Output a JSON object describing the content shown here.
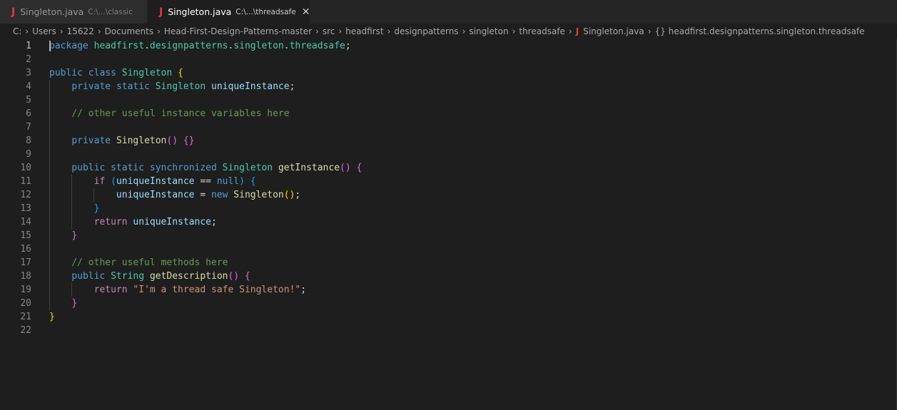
{
  "tabs": [
    {
      "name": "Singleton.java",
      "path": "C:\\...\\classic",
      "active": false
    },
    {
      "name": "Singleton.java",
      "path": "C:\\...\\threadsafe",
      "active": true
    }
  ],
  "breadcrumb": [
    "C:",
    "Users",
    "15622",
    "Documents",
    "Head-First-Design-Patterns-master",
    "src",
    "headfirst",
    "designpatterns",
    "singleton",
    "threadsafe",
    "Singleton.java",
    "headfirst.designpatterns.singleton.threadsafe"
  ],
  "icons": {
    "java": "java-file-icon",
    "close": "close-icon",
    "namespace": "braces-icon",
    "chevron": "chevron-right-icon"
  },
  "colors": {
    "java_icon": "#e03c3c",
    "background": "#1e1e1e",
    "keyword": "#569cd6",
    "class": "#4ec9b0",
    "comment": "#6a9955",
    "string": "#ce9178"
  },
  "line_numbers": [
    "1",
    "2",
    "3",
    "4",
    "5",
    "6",
    "7",
    "8",
    "9",
    "10",
    "11",
    "12",
    "13",
    "14",
    "15",
    "16",
    "17",
    "18",
    "19",
    "20",
    "21",
    "22"
  ],
  "current_line": 1,
  "code": [
    {
      "tokens": [
        [
          "kw",
          "package"
        ],
        [
          "op",
          " "
        ],
        [
          "pkg",
          "headfirst"
        ],
        [
          "op",
          "."
        ],
        [
          "pkg",
          "designpatterns"
        ],
        [
          "op",
          "."
        ],
        [
          "pkg",
          "singleton"
        ],
        [
          "op",
          "."
        ],
        [
          "pkg",
          "threadsafe"
        ],
        [
          "op",
          ";"
        ]
      ]
    },
    {
      "tokens": []
    },
    {
      "tokens": [
        [
          "kw",
          "public"
        ],
        [
          "op",
          " "
        ],
        [
          "kw",
          "class"
        ],
        [
          "op",
          " "
        ],
        [
          "cls",
          "Singleton"
        ],
        [
          "op",
          " "
        ],
        [
          "p1",
          "{"
        ]
      ]
    },
    {
      "tokens": [
        [
          "op",
          "    "
        ],
        [
          "kw",
          "private"
        ],
        [
          "op",
          " "
        ],
        [
          "kw",
          "static"
        ],
        [
          "op",
          " "
        ],
        [
          "cls",
          "Singleton"
        ],
        [
          "op",
          " "
        ],
        [
          "var",
          "uniqueInstance"
        ],
        [
          "op",
          ";"
        ]
      ]
    },
    {
      "tokens": []
    },
    {
      "tokens": [
        [
          "op",
          "    "
        ],
        [
          "cm",
          "// other useful instance variables here"
        ]
      ]
    },
    {
      "tokens": []
    },
    {
      "tokens": [
        [
          "op",
          "    "
        ],
        [
          "kw",
          "private"
        ],
        [
          "op",
          " "
        ],
        [
          "fn",
          "Singleton"
        ],
        [
          "p2",
          "()"
        ],
        [
          "op",
          " "
        ],
        [
          "p2",
          "{}"
        ]
      ]
    },
    {
      "tokens": []
    },
    {
      "tokens": [
        [
          "op",
          "    "
        ],
        [
          "kw",
          "public"
        ],
        [
          "op",
          " "
        ],
        [
          "kw",
          "static"
        ],
        [
          "op",
          " "
        ],
        [
          "kw",
          "synchronized"
        ],
        [
          "op",
          " "
        ],
        [
          "cls",
          "Singleton"
        ],
        [
          "op",
          " "
        ],
        [
          "fn",
          "getInstance"
        ],
        [
          "p2",
          "()"
        ],
        [
          "op",
          " "
        ],
        [
          "p2",
          "{"
        ]
      ]
    },
    {
      "tokens": [
        [
          "op",
          "        "
        ],
        [
          "kw2",
          "if"
        ],
        [
          "op",
          " "
        ],
        [
          "p3",
          "("
        ],
        [
          "var",
          "uniqueInstance"
        ],
        [
          "op",
          " == "
        ],
        [
          "kw",
          "null"
        ],
        [
          "p3",
          ")"
        ],
        [
          "op",
          " "
        ],
        [
          "p3",
          "{"
        ]
      ]
    },
    {
      "tokens": [
        [
          "op",
          "            "
        ],
        [
          "var",
          "uniqueInstance"
        ],
        [
          "op",
          " = "
        ],
        [
          "kw",
          "new"
        ],
        [
          "op",
          " "
        ],
        [
          "fn",
          "Singleton"
        ],
        [
          "p1",
          "()"
        ],
        [
          "op",
          ";"
        ]
      ]
    },
    {
      "tokens": [
        [
          "op",
          "        "
        ],
        [
          "p3",
          "}"
        ]
      ]
    },
    {
      "tokens": [
        [
          "op",
          "        "
        ],
        [
          "kw2",
          "return"
        ],
        [
          "op",
          " "
        ],
        [
          "var",
          "uniqueInstance"
        ],
        [
          "op",
          ";"
        ]
      ]
    },
    {
      "tokens": [
        [
          "op",
          "    "
        ],
        [
          "p2",
          "}"
        ]
      ]
    },
    {
      "tokens": []
    },
    {
      "tokens": [
        [
          "op",
          "    "
        ],
        [
          "cm",
          "// other useful methods here"
        ]
      ]
    },
    {
      "tokens": [
        [
          "op",
          "    "
        ],
        [
          "kw",
          "public"
        ],
        [
          "op",
          " "
        ],
        [
          "ty",
          "String"
        ],
        [
          "op",
          " "
        ],
        [
          "fn",
          "getDescription"
        ],
        [
          "p2",
          "()"
        ],
        [
          "op",
          " "
        ],
        [
          "p2",
          "{"
        ]
      ]
    },
    {
      "tokens": [
        [
          "op",
          "        "
        ],
        [
          "kw2",
          "return"
        ],
        [
          "op",
          " "
        ],
        [
          "str",
          "\"I'm a thread safe Singleton!\""
        ],
        [
          "op",
          ";"
        ]
      ]
    },
    {
      "tokens": [
        [
          "op",
          "    "
        ],
        [
          "p2",
          "}"
        ]
      ]
    },
    {
      "tokens": [
        [
          "p1",
          "}"
        ]
      ]
    },
    {
      "tokens": []
    }
  ]
}
